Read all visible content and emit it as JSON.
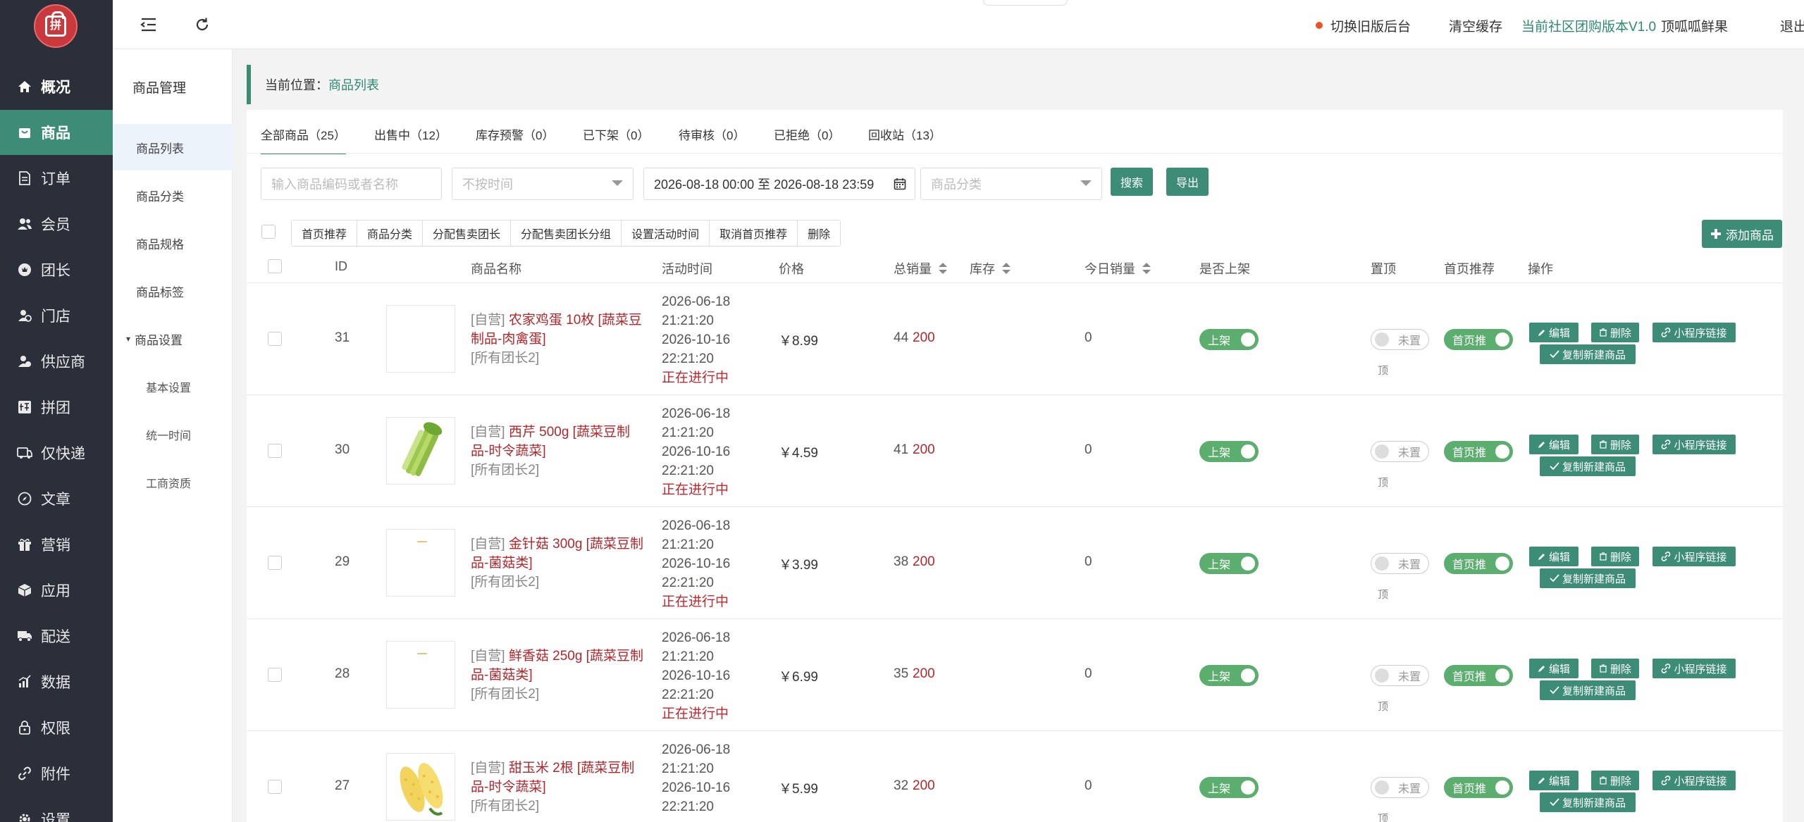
{
  "sidebar": {
    "logo_text": "拼",
    "items": [
      {
        "label": "概况",
        "icon": "home-icon"
      },
      {
        "label": "商品",
        "icon": "bag-icon"
      },
      {
        "label": "订单",
        "icon": "document-icon"
      },
      {
        "label": "会员",
        "icon": "users-icon"
      },
      {
        "label": "团长",
        "icon": "leader-icon"
      },
      {
        "label": "门店",
        "icon": "store-icon"
      },
      {
        "label": "供应商",
        "icon": "supplier-icon"
      },
      {
        "label": "拼团",
        "icon": "group-icon"
      },
      {
        "label": "仅快递",
        "icon": "express-icon"
      },
      {
        "label": "文章",
        "icon": "compass-icon"
      },
      {
        "label": "营销",
        "icon": "gift-icon"
      },
      {
        "label": "应用",
        "icon": "cube-icon"
      },
      {
        "label": "配送",
        "icon": "truck-icon"
      },
      {
        "label": "数据",
        "icon": "chart-icon"
      },
      {
        "label": "权限",
        "icon": "lock-icon"
      },
      {
        "label": "附件",
        "icon": "link-icon"
      },
      {
        "label": "设置",
        "icon": "gear-icon"
      }
    ]
  },
  "subnav": {
    "title": "商品管理",
    "items": [
      "商品列表",
      "商品分类",
      "商品规格",
      "商品标签",
      "商品设置"
    ],
    "children": [
      "基本设置",
      "统一时间",
      "工商资质"
    ]
  },
  "header": {
    "switch_old": "切换旧版后台",
    "clear_cache": "清空缓存",
    "version": "当前社区团购版本V1.0",
    "shop": "顶呱呱鲜果",
    "logout": "退出"
  },
  "breadcrumb": {
    "label": "当前位置：",
    "current": "商品列表"
  },
  "tabs": [
    {
      "label": "全部商品（25）"
    },
    {
      "label": "出售中（12）"
    },
    {
      "label": "库存预警（0）"
    },
    {
      "label": "已下架（0）"
    },
    {
      "label": "待审核（0）"
    },
    {
      "label": "已拒绝（0）"
    },
    {
      "label": "回收站（13）"
    }
  ],
  "filters": {
    "keyword_placeholder": "输入商品编码或者名称",
    "time_placeholder": "不按时间",
    "date_range": "2026-08-18 00:00 至 2026-08-18 23:59",
    "category_placeholder": "商品分类",
    "search": "搜索",
    "export": "导出"
  },
  "bulk": [
    "首页推荐",
    "商品分类",
    "分配售卖团长",
    "分配售卖团长分组",
    "设置活动时间",
    "取消首页推荐",
    "删除"
  ],
  "add_button": "添加商品",
  "columns": {
    "id": "ID",
    "name": "商品名称",
    "time": "活动时间",
    "price": "价格",
    "total_sales": "总销量",
    "stock": "库存",
    "today_sales": "今日销量",
    "on_shelf": "是否上架",
    "pin_top": "置顶",
    "home_rec": "首页推荐",
    "ops": "操作"
  },
  "labels": {
    "self": "[自营]",
    "on": "上架",
    "pin_off": "未置",
    "pin_off_2": "顶",
    "rec_on": "首页推",
    "edit": "编辑",
    "delete": "删除",
    "mini_link": "小程序链接",
    "copy_new": "复制新建商品"
  },
  "rows": [
    {
      "id": "31",
      "name": "农家鸡蛋 10枚 [蔬菜豆制品-肉禽蛋]",
      "group": "[所有团长2]",
      "start_date": "2026-06-18",
      "start_time": "21:21:20",
      "end_date": "2026-10-16",
      "end_time": "22:21:20",
      "status": "正在进行中",
      "price": "￥8.99",
      "total_sales": "44",
      "stock": "200",
      "today_sales": "0",
      "thumb": "blank"
    },
    {
      "id": "30",
      "name": "西芹 500g [蔬菜豆制品-时令蔬菜]",
      "group": "[所有团长2]",
      "start_date": "2026-06-18",
      "start_time": "21:21:20",
      "end_date": "2026-10-16",
      "end_time": "22:21:20",
      "status": "正在进行中",
      "price": "￥4.59",
      "total_sales": "41",
      "stock": "200",
      "today_sales": "0",
      "thumb": "celery"
    },
    {
      "id": "29",
      "name": "金针菇 300g [蔬菜豆制品-菌菇类]",
      "group": "[所有团长2]",
      "start_date": "2026-06-18",
      "start_time": "21:21:20",
      "end_date": "2026-10-16",
      "end_time": "22:21:20",
      "status": "正在进行中",
      "price": "￥3.99",
      "total_sales": "38",
      "stock": "200",
      "today_sales": "0",
      "thumb": "speck"
    },
    {
      "id": "28",
      "name": "鲜香菇 250g [蔬菜豆制品-菌菇类]",
      "group": "[所有团长2]",
      "start_date": "2026-06-18",
      "start_time": "21:21:20",
      "end_date": "2026-10-16",
      "end_time": "22:21:20",
      "status": "正在进行中",
      "price": "￥6.99",
      "total_sales": "35",
      "stock": "200",
      "today_sales": "0",
      "thumb": "speck"
    },
    {
      "id": "27",
      "name": "甜玉米 2根 [蔬菜豆制品-时令蔬菜]",
      "group": "[所有团长2]",
      "start_date": "2026-06-18",
      "start_time": "21:21:20",
      "end_date": "2026-10-16",
      "end_time": "22:21:20",
      "status": "",
      "price": "￥5.99",
      "total_sales": "32",
      "stock": "200",
      "today_sales": "0",
      "thumb": "corn"
    }
  ],
  "colors": {
    "brand": "#3d8d76",
    "product_name": "#b3262b",
    "status": "#c0272d",
    "logo": "#c9393c"
  }
}
